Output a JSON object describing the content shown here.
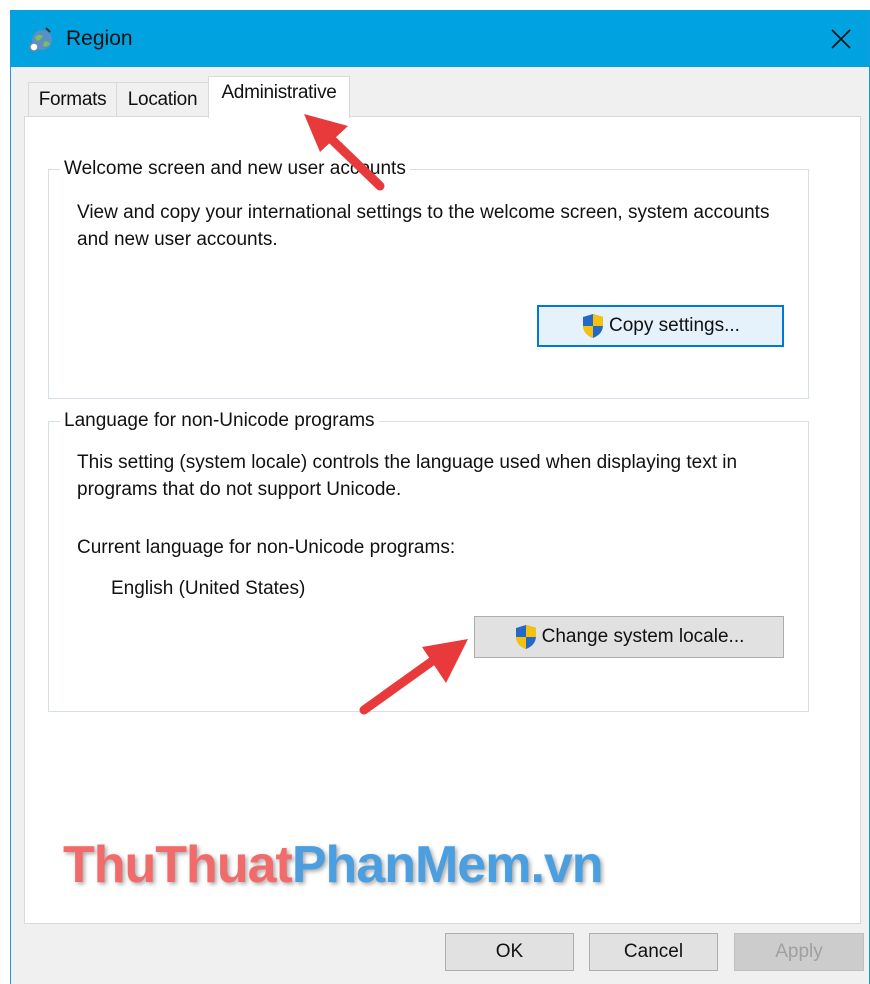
{
  "window": {
    "title": "Region"
  },
  "tabs": [
    {
      "label": "Formats"
    },
    {
      "label": "Location"
    },
    {
      "label": "Administrative",
      "active": true
    }
  ],
  "welcome_group": {
    "legend": "Welcome screen and new user accounts",
    "description": "View and copy your international settings to the welcome screen, system accounts and new user accounts.",
    "button_label": "Copy settings..."
  },
  "unicode_group": {
    "legend": "Language for non-Unicode programs",
    "description": "This setting (system locale) controls the language used when displaying text in programs that do not support Unicode.",
    "current_label": "Current language for non-Unicode programs:",
    "current_value": "English (United States)",
    "button_label": "Change system locale..."
  },
  "footer": {
    "ok_label": "OK",
    "cancel_label": "Cancel",
    "apply_label": "Apply"
  },
  "watermark": {
    "part1": "ThuThuat",
    "part2": "PhanMem",
    "part3": ".vn"
  },
  "colors": {
    "titlebar": "#00a2e0",
    "arrow": "#e8393b",
    "default_button_border": "#0078d7"
  },
  "icons": {
    "title": "globe-region-icon",
    "close": "close-icon",
    "button_shield": "uac-shield-icon"
  }
}
